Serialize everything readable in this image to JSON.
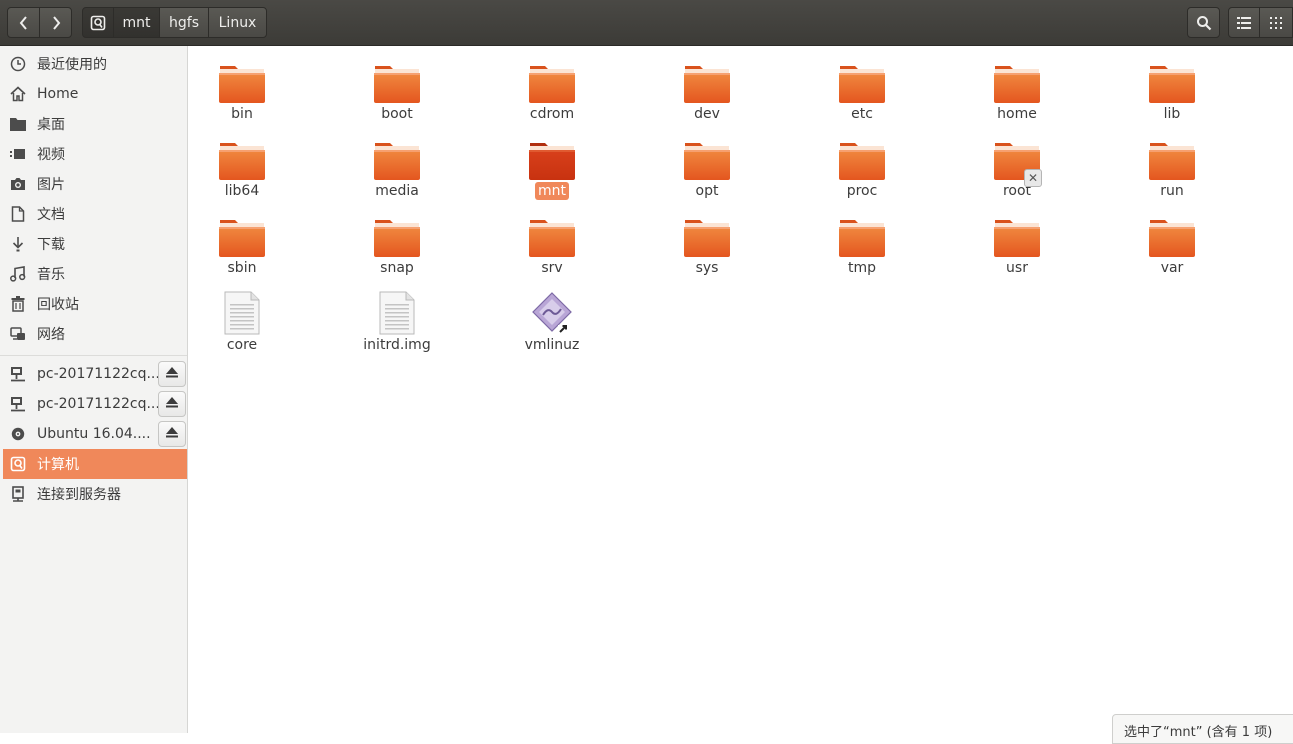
{
  "header": {
    "breadcrumbs": [
      "mnt",
      "hgfs",
      "Linux"
    ],
    "icons": {
      "back": "chevron-left-icon",
      "forward": "chevron-right-icon",
      "root": "drive-icon",
      "search": "search-icon",
      "list_view": "list-view-icon",
      "grid_view": "grid-view-icon"
    }
  },
  "sidebar": {
    "places": [
      {
        "label": "最近使用的",
        "icon": "recent-icon"
      },
      {
        "label": "Home",
        "icon": "home-icon"
      },
      {
        "label": "桌面",
        "icon": "desktop-folder-icon"
      },
      {
        "label": "视频",
        "icon": "video-icon"
      },
      {
        "label": "图片",
        "icon": "camera-icon"
      },
      {
        "label": "文档",
        "icon": "document-icon"
      },
      {
        "label": "下载",
        "icon": "download-icon"
      },
      {
        "label": "音乐",
        "icon": "music-icon"
      },
      {
        "label": "回收站",
        "icon": "trash-icon"
      },
      {
        "label": "网络",
        "icon": "network-icon"
      }
    ],
    "devices": [
      {
        "label": "pc-20171122cq...",
        "icon": "network-share-icon",
        "eject": true
      },
      {
        "label": "pc-20171122cq...",
        "icon": "network-share-icon",
        "eject": true
      },
      {
        "label": "Ubuntu 16.04....",
        "icon": "disc-icon",
        "eject": true
      },
      {
        "label": "计算机",
        "icon": "computer-icon",
        "eject": false,
        "active": true
      },
      {
        "label": "连接到服务器",
        "icon": "connect-server-icon",
        "eject": false
      }
    ]
  },
  "files": [
    {
      "name": "bin",
      "type": "folder"
    },
    {
      "name": "boot",
      "type": "folder"
    },
    {
      "name": "cdrom",
      "type": "folder"
    },
    {
      "name": "dev",
      "type": "folder"
    },
    {
      "name": "etc",
      "type": "folder"
    },
    {
      "name": "home",
      "type": "folder"
    },
    {
      "name": "lib",
      "type": "folder"
    },
    {
      "name": "lib64",
      "type": "folder"
    },
    {
      "name": "media",
      "type": "folder"
    },
    {
      "name": "mnt",
      "type": "folder",
      "selected": true
    },
    {
      "name": "opt",
      "type": "folder"
    },
    {
      "name": "proc",
      "type": "folder"
    },
    {
      "name": "root",
      "type": "folder",
      "locked": true
    },
    {
      "name": "run",
      "type": "folder"
    },
    {
      "name": "sbin",
      "type": "folder"
    },
    {
      "name": "snap",
      "type": "folder"
    },
    {
      "name": "srv",
      "type": "folder"
    },
    {
      "name": "sys",
      "type": "folder"
    },
    {
      "name": "tmp",
      "type": "folder"
    },
    {
      "name": "usr",
      "type": "folder"
    },
    {
      "name": "var",
      "type": "folder"
    },
    {
      "name": "core",
      "type": "text-file"
    },
    {
      "name": "initrd.img",
      "type": "text-file"
    },
    {
      "name": "vmlinuz",
      "type": "symlink-binary"
    }
  ],
  "status": "选中了“mnt” (含有 1 项)",
  "colors": {
    "accent": "#f0885a",
    "folder": "#e95420",
    "header": "#3c3b37"
  }
}
